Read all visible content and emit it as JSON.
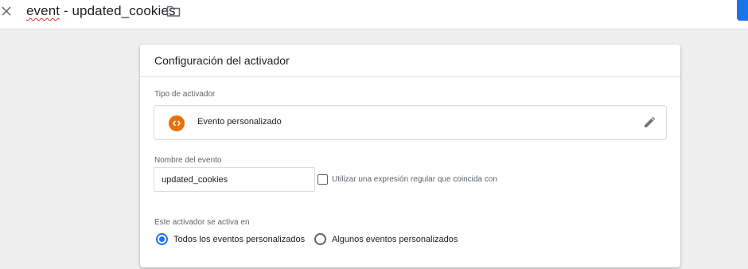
{
  "header": {
    "title_part1": "event",
    "title_part2": " - updated_cookies",
    "close_icon": "close-icon",
    "folder_icon": "folder-icon",
    "accent_color": "#1a73e8"
  },
  "card": {
    "title": "Configuración del activador",
    "trigger_type": {
      "label": "Tipo de activador",
      "name": "Evento personalizado",
      "icon": "custom-event-icon",
      "icon_color": "#e8710a",
      "edit_icon": "pencil-icon"
    },
    "event_name": {
      "label": "Nombre del evento",
      "value": "updated_cookies",
      "regex_checkbox_label": "Utilizar una expresión regular que coincida con",
      "regex_checked": false
    },
    "fires_on": {
      "label": "Este activador se activa en",
      "options": [
        {
          "label": "Todos los eventos personalizados",
          "selected": true
        },
        {
          "label": "Algunos eventos personalizados",
          "selected": false
        }
      ]
    }
  }
}
